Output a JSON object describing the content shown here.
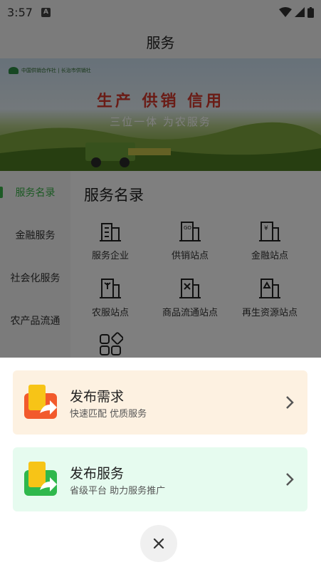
{
  "status_bar": {
    "time": "3:57",
    "badge": "A"
  },
  "header": {
    "title": "服务"
  },
  "banner": {
    "logo_text": "中国供销合作社 | 长治市供销社",
    "slogan": "生产 供销 信用",
    "subtitle": "三位一体 为农服务"
  },
  "sidebar": {
    "items": [
      {
        "label": "服务名录",
        "active": true
      },
      {
        "label": "金融服务",
        "active": false
      },
      {
        "label": "社会化服务",
        "active": false
      },
      {
        "label": "农产品流通",
        "active": false
      }
    ]
  },
  "content": {
    "title": "服务名录",
    "items": [
      {
        "label": "服务企业",
        "icon": "building-icon"
      },
      {
        "label": "供销站点",
        "icon": "co-op-station-icon"
      },
      {
        "label": "金融站点",
        "icon": "finance-station-icon"
      },
      {
        "label": "农服站点",
        "icon": "agri-station-icon"
      },
      {
        "label": "商品流通站点",
        "icon": "commerce-station-icon"
      },
      {
        "label": "再生资源站点",
        "icon": "recycle-station-icon"
      },
      {
        "label": "",
        "icon": "more-grid-icon"
      }
    ]
  },
  "sheet": {
    "actions": [
      {
        "title": "发布需求",
        "subtitle": "快速匹配 优质服务",
        "icon": "publish-demand-icon",
        "color": "#f25a2c"
      },
      {
        "title": "发布服务",
        "subtitle": "省级平台 助力服务推广",
        "icon": "publish-service-icon",
        "color": "#2fb84c"
      }
    ],
    "close_icon": "close-icon"
  },
  "colors": {
    "accent": "#3bb54a",
    "demand_bg": "#fdf1e1",
    "service_bg": "#e6fbef"
  }
}
